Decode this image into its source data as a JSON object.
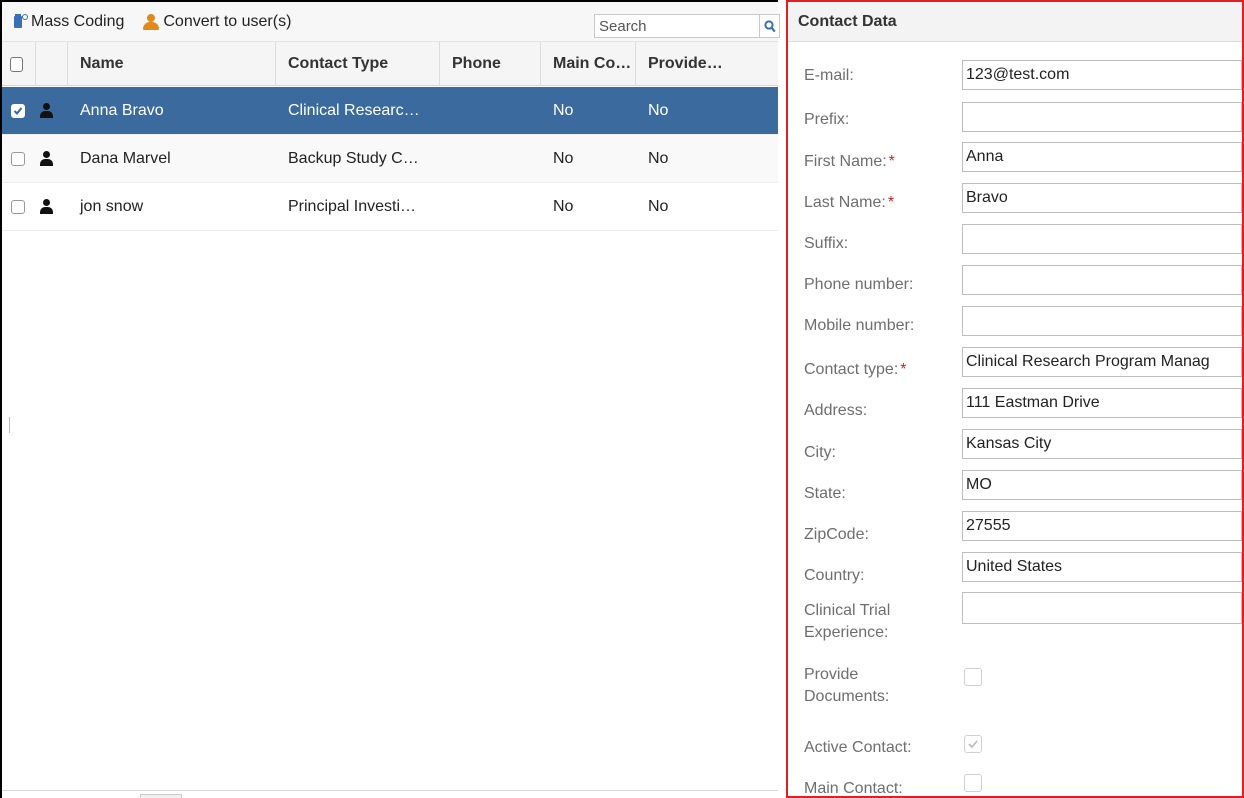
{
  "toolbar": {
    "mass_coding_label": "Mass Coding",
    "convert_label": "Convert to user(s)",
    "search_placeholder": "Search"
  },
  "grid": {
    "columns": {
      "name": "Name",
      "contact_type": "Contact Type",
      "phone": "Phone",
      "main_contact": "Main Co…",
      "provide": "Provide…"
    },
    "rows": [
      {
        "name": "Anna Bravo",
        "contact_type": "Clinical Researc…",
        "phone": "",
        "main_contact": "No",
        "provide": "No",
        "checked": true
      },
      {
        "name": "Dana Marvel",
        "contact_type": "Backup Study C…",
        "phone": "",
        "main_contact": "No",
        "provide": "No",
        "checked": false
      },
      {
        "name": "jon snow",
        "contact_type": "Principal Investi…",
        "phone": "",
        "main_contact": "No",
        "provide": "No",
        "checked": false
      }
    ]
  },
  "contact_panel": {
    "title": "Contact Data",
    "fields": {
      "email": {
        "label": "E-mail:",
        "value": "123@test.com"
      },
      "prefix": {
        "label": "Prefix:",
        "value": ""
      },
      "first_name": {
        "label": "First Name:",
        "value": "Anna",
        "required": "*"
      },
      "last_name": {
        "label": "Last Name:",
        "value": "Bravo",
        "required": "*"
      },
      "suffix": {
        "label": "Suffix:",
        "value": ""
      },
      "phone": {
        "label": "Phone number:",
        "value": ""
      },
      "mobile": {
        "label": "Mobile number:",
        "value": ""
      },
      "contact_type": {
        "label": "Contact type:",
        "value": "Clinical Research Program Manag",
        "required": "*"
      },
      "address": {
        "label": "Address:",
        "value": "111 Eastman Drive"
      },
      "city": {
        "label": "City:",
        "value": "Kansas City"
      },
      "state": {
        "label": "State:",
        "value": "MO"
      },
      "zipcode": {
        "label": "ZipCode:",
        "value": "27555"
      },
      "country": {
        "label": "Country:",
        "value": "United States"
      },
      "trial_experience": {
        "label_line1": "Clinical Trial",
        "label_line2": "Experience:",
        "value": ""
      },
      "provide_documents": {
        "label_line1": "Provide",
        "label_line2": "Documents:",
        "checked": false
      },
      "active_contact": {
        "label": "Active Contact:",
        "checked": true
      },
      "main_contact": {
        "label": "Main Contact:",
        "checked": false
      }
    }
  },
  "colors": {
    "selected_row": "#3a6a9e",
    "panel_highlight": "#e02020",
    "required_mark": "#d02020",
    "icon_orange": "#e08a1e",
    "icon_blue": "#3b6fb5"
  }
}
